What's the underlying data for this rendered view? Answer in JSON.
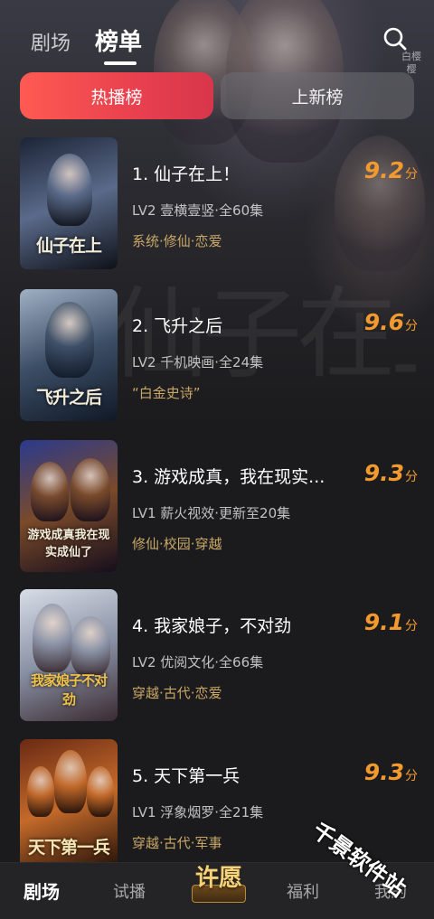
{
  "top_tabs": {
    "theater": "剧场",
    "ranking": "榜单"
  },
  "hero": {
    "side_text": "白樱樱"
  },
  "sub_tabs": {
    "hot": "热播榜",
    "new": "上新榜"
  },
  "items": [
    {
      "title": "1. 仙子在上！",
      "meta": "LV2 壹横壹竖·全60集",
      "tags": "系统·修仙·恋爱",
      "score": "9.2",
      "score_unit": "分",
      "poster_title": "仙子在上",
      "poster_colors": [
        "#1c2436",
        "#5a6a8a",
        "#0e1118"
      ]
    },
    {
      "title": "2. 飞升之后",
      "meta": "LV2 千机映画·全24集",
      "tags": "“白金史诗”",
      "score": "9.6",
      "score_unit": "分",
      "poster_title": "飞升之后",
      "poster_colors": [
        "#9fb0c4",
        "#3c4e66",
        "#101826"
      ]
    },
    {
      "title": "3. 游戏成真，我在现实...",
      "meta": "LV1 薪火视效·更新至20集",
      "tags": "修仙·校园·穿越",
      "score": "9.3",
      "score_unit": "分",
      "poster_title": "游戏成真我在现实成仙了",
      "poster_colors": [
        "#2a3a8c",
        "#7a4a2a",
        "#160e1c"
      ]
    },
    {
      "title": "4. 我家娘子，不对劲",
      "meta": "LV2 优阅文化·全66集",
      "tags": "穿越·古代·恋爱",
      "score": "9.1",
      "score_unit": "分",
      "poster_title": "我家娘子不对劲",
      "poster_colors": [
        "#d8dde6",
        "#8a92a6",
        "#3a2a30"
      ]
    },
    {
      "title": "5. 天下第一兵",
      "meta": "LV1 浮象烟罗·全21集",
      "tags": "穿越·古代·军事",
      "score": "9.3",
      "score_unit": "分",
      "poster_title": "天下第一兵",
      "poster_colors": [
        "#6a2a14",
        "#c46a2a",
        "#1e0e08"
      ]
    }
  ],
  "bottom_nav": {
    "theater": "剧场",
    "trial": "试播",
    "wish": "许愿",
    "welfare": "福利",
    "mine": "我的"
  },
  "watermark": "千景软件站"
}
